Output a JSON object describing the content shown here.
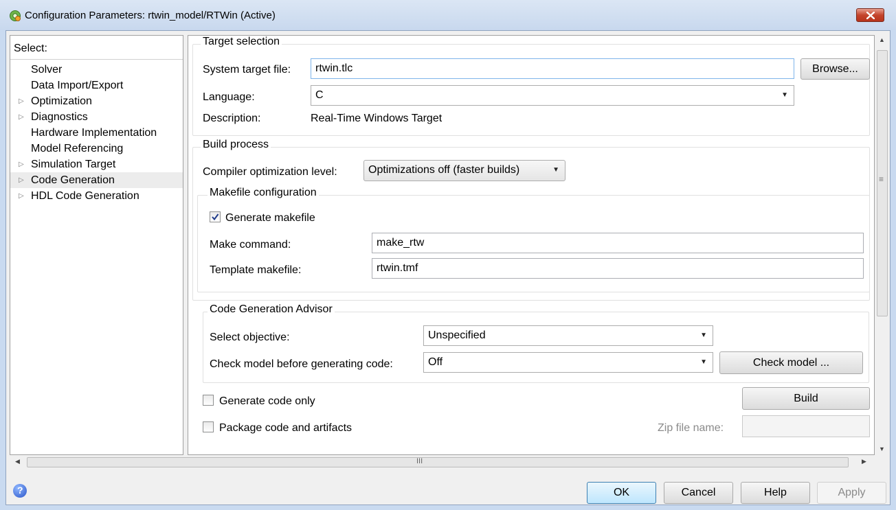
{
  "window": {
    "title": "Configuration Parameters: rtwin_model/RTWin (Active)",
    "close_symbol": "✕"
  },
  "tree": {
    "title": "Select:",
    "items": [
      {
        "label": "Solver",
        "expandable": false
      },
      {
        "label": "Data Import/Export",
        "expandable": false
      },
      {
        "label": "Optimization",
        "expandable": true
      },
      {
        "label": "Diagnostics",
        "expandable": true
      },
      {
        "label": "Hardware Implementation",
        "expandable": false
      },
      {
        "label": "Model Referencing",
        "expandable": false
      },
      {
        "label": "Simulation Target",
        "expandable": true
      },
      {
        "label": "Code Generation",
        "expandable": true,
        "selected": true
      },
      {
        "label": "HDL Code Generation",
        "expandable": true
      }
    ],
    "arrow_glyph": "▷"
  },
  "target_selection": {
    "title": "Target selection",
    "system_target_label": "System target file:",
    "system_target_value": "rtwin.tlc",
    "browse_label": "Browse...",
    "language_label": "Language:",
    "language_value": "C",
    "description_label": "Description:",
    "description_value": "Real-Time Windows Target"
  },
  "build_process": {
    "title": "Build process",
    "compiler_label": "Compiler optimization level:",
    "compiler_value": "Optimizations off (faster builds)",
    "makefile": {
      "title": "Makefile configuration",
      "generate_label": "Generate makefile",
      "generate_checked": true,
      "make_command_label": "Make command:",
      "make_command_value": "make_rtw",
      "template_label": "Template makefile:",
      "template_value": "rtwin.tmf"
    }
  },
  "advisor": {
    "title": "Code Generation Advisor",
    "objective_label": "Select objective:",
    "objective_value": "Unspecified",
    "check_label": "Check model before generating code:",
    "check_value": "Off",
    "check_button": "Check model ..."
  },
  "options": {
    "generate_only_label": "Generate code only",
    "generate_only_checked": false,
    "build_label": "Build",
    "package_label": "Package code and artifacts",
    "package_checked": false,
    "zip_label": "Zip file name:",
    "zip_value": ""
  },
  "scroll": {
    "grip": "III",
    "up": "▲",
    "down": "▼",
    "left": "◀",
    "right": "▶",
    "middle_grip": "≡"
  },
  "footer": {
    "help_icon_text": "?",
    "ok": "OK",
    "cancel": "Cancel",
    "help": "Help",
    "apply": "Apply"
  },
  "colors": {
    "accent": "#3c7fb1",
    "close": "#c4442c",
    "selected_bg": "#ececec"
  }
}
